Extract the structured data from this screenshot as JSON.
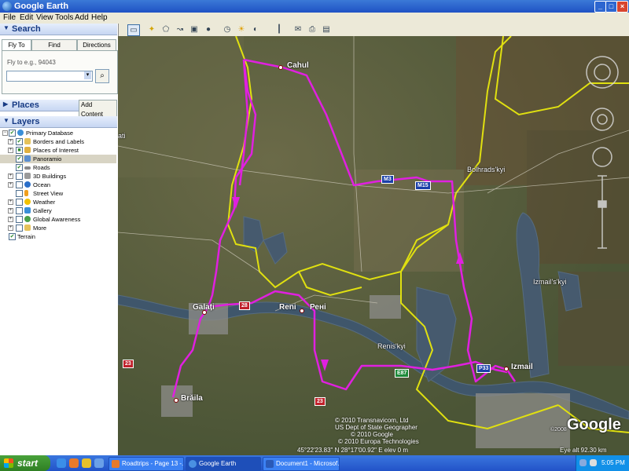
{
  "window": {
    "title": "Google Earth",
    "minimize": "_",
    "maximize": "□",
    "close": "×"
  },
  "menu": [
    "File",
    "Edit",
    "View",
    "Tools",
    "Add",
    "Help"
  ],
  "sidebar": {
    "search": {
      "heading": "Search",
      "tabs": [
        "Fly To",
        "Find Businesses",
        "Directions"
      ],
      "flyto_placeholder": "Fly to e.g., 94043",
      "flyto_value": ""
    },
    "places": {
      "heading": "Places",
      "add_content": "Add Content"
    },
    "layers": {
      "heading": "Layers",
      "items": [
        {
          "label": "Primary Database",
          "checked": true,
          "icon": "globe-icon"
        },
        {
          "label": "Borders and Labels",
          "checked": true,
          "icon": "borders-icon"
        },
        {
          "label": "Places of Interest",
          "checked": true,
          "icon": "poi-icon"
        },
        {
          "label": "Panoramio",
          "checked": true,
          "icon": "photo-icon"
        },
        {
          "label": "Roads",
          "checked": true,
          "icon": "road-icon"
        },
        {
          "label": "3D Buildings",
          "checked": false,
          "icon": "building-icon"
        },
        {
          "label": "Ocean",
          "checked": false,
          "icon": "ocean-icon"
        },
        {
          "label": "Street View",
          "checked": false,
          "icon": "streetview-icon"
        },
        {
          "label": "Weather",
          "checked": false,
          "icon": "weather-icon"
        },
        {
          "label": "Gallery",
          "checked": false,
          "icon": "gallery-icon"
        },
        {
          "label": "Global Awareness",
          "checked": false,
          "icon": "awareness-icon"
        },
        {
          "label": "More",
          "checked": false,
          "icon": "more-icon"
        },
        {
          "label": "Terrain",
          "checked": true,
          "icon": "terrain-icon"
        }
      ]
    }
  },
  "map": {
    "labels": {
      "cahul": "Cahul",
      "bolhrads": "Bolhrads'kyi",
      "izmails": "Izmail's'kyi",
      "reni": "Reni",
      "reni_cyr": "Рені",
      "renis": "Renis'kyi",
      "izmail": "Izmail",
      "galati": "Galați",
      "braila": "Brăila",
      "ati": "ati"
    },
    "shields": {
      "m3": "M3",
      "m15": "M15",
      "r33": "P33",
      "e87": "E87",
      "e23a": "23",
      "e23b": "23",
      "e28": "28"
    },
    "copyright": [
      "© 2010 Transnavicom, Ltd",
      "US Dept of State Geographer",
      "© 2010 Google",
      "© 2010 Europa Technologies"
    ],
    "status": {
      "coords": "45°22'23.83\" N    28°17'00.92\" E    elev    0 m",
      "eye_alt": "Eye alt   92.30 km"
    },
    "logo": "Google",
    "logo_year": "©2008"
  },
  "taskbar": {
    "start": "start",
    "tasks": [
      "Roadtrips - Page 13 -...",
      "Google Earth",
      "Document1 - Microsof..."
    ],
    "clock": "5:05 PM"
  }
}
